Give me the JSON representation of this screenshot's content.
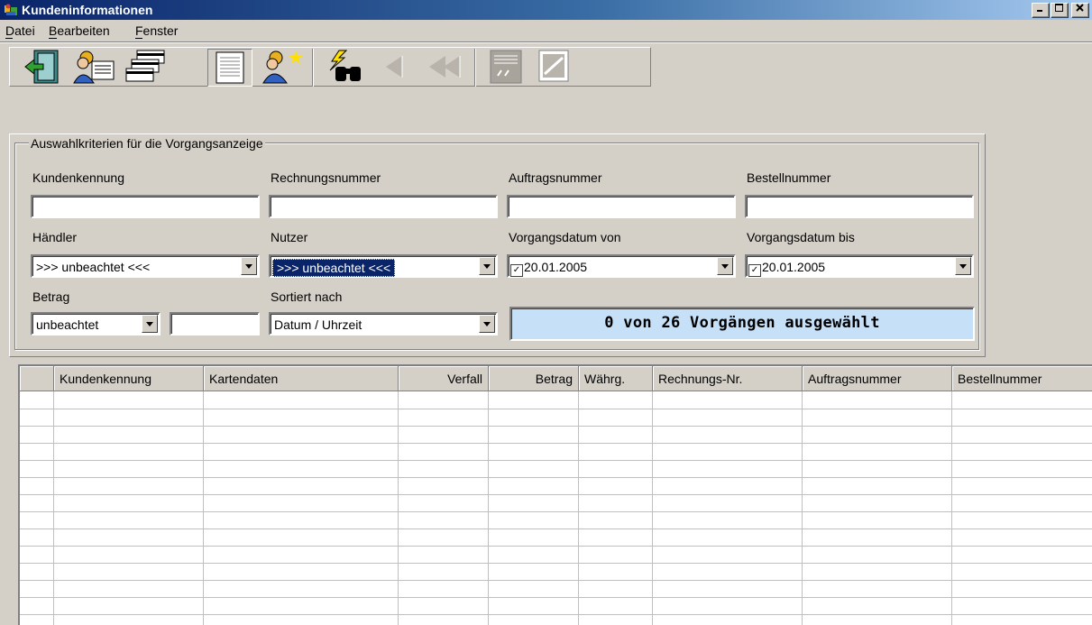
{
  "window": {
    "title": "Kundeninformationen"
  },
  "menu": [
    {
      "label": "Datei",
      "accel": "D"
    },
    {
      "label": "Bearbeiten",
      "accel": "B"
    },
    {
      "label": "Fenster",
      "accel": "F"
    }
  ],
  "toolbar": {
    "buttons": [
      {
        "name": "exit-icon",
        "enabled": true
      },
      {
        "name": "customer-card-icon",
        "enabled": true
      },
      {
        "name": "cards-stack-icon",
        "enabled": true
      },
      {
        "name": "list-document-icon",
        "enabled": true,
        "pressed": true
      },
      {
        "name": "new-customer-icon",
        "enabled": true
      },
      {
        "name": "search-binoculars-icon",
        "enabled": true
      },
      {
        "name": "back-arrow-icon",
        "enabled": false
      },
      {
        "name": "fast-back-arrow-icon",
        "enabled": false
      },
      {
        "name": "terminal-icon",
        "enabled": false
      },
      {
        "name": "card-scan-icon",
        "enabled": false
      }
    ]
  },
  "criteria": {
    "group_label": "Auswahlkriterien für die Vorgangsanzeige",
    "kundenkennung": {
      "label": "Kundenkennung",
      "value": ""
    },
    "rechnungsnummer": {
      "label": "Rechnungsnummer",
      "value": ""
    },
    "auftragsnummer": {
      "label": "Auftragsnummer",
      "value": ""
    },
    "bestellnummer": {
      "label": "Bestellnummer",
      "value": ""
    },
    "haendler": {
      "label": "Händler",
      "value": ">>> unbeachtet <<<"
    },
    "nutzer": {
      "label": "Nutzer",
      "value": ">>> unbeachtet <<<"
    },
    "datum_von": {
      "label": "Vorgangsdatum von",
      "value": "20.01.2005",
      "checked": true
    },
    "datum_bis": {
      "label": "Vorgangsdatum bis",
      "value": "20.01.2005",
      "checked": true
    },
    "betrag": {
      "label": "Betrag",
      "operator": "unbeachtet",
      "value": ""
    },
    "sortiert": {
      "label": "Sortiert nach",
      "value": "Datum / Uhrzeit"
    },
    "status": "0 von 26 Vorgängen ausgewählt"
  },
  "grid": {
    "columns": [
      "",
      "Kundenkennung",
      "Kartendaten",
      "Verfall",
      "Betrag",
      "Währg.",
      "Rechnungs-Nr.",
      "Auftragsnummer",
      "Bestellnummer"
    ],
    "rows": []
  },
  "colors": {
    "window_bg": "#d4d0c8",
    "title_start": "#0a246a",
    "title_end": "#a6caf0",
    "status_bg": "#c6e0f8"
  }
}
